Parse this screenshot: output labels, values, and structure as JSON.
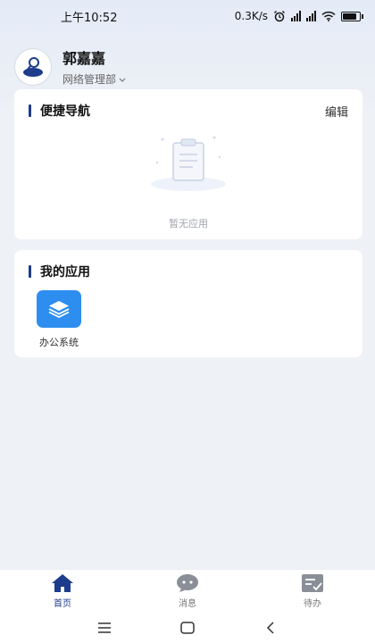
{
  "status": {
    "time": "上午10:52",
    "speed": "0.3K/s"
  },
  "profile": {
    "name": "郭嘉嘉",
    "department": "网络管理部"
  },
  "quick_nav": {
    "title": "便捷导航",
    "edit_label": "编辑",
    "empty_text": "暂无应用"
  },
  "my_apps": {
    "title": "我的应用",
    "items": [
      {
        "label": "办公系统",
        "icon": "layers-icon"
      }
    ]
  },
  "tabs": [
    {
      "label": "首页",
      "icon": "home-icon",
      "active": true
    },
    {
      "label": "消息",
      "icon": "chat-icon",
      "active": false
    },
    {
      "label": "待办",
      "icon": "todo-icon",
      "active": false
    }
  ],
  "colors": {
    "accent": "#1e3c8c",
    "app_icon": "#2e8ef0",
    "background": "#eef1f6"
  }
}
